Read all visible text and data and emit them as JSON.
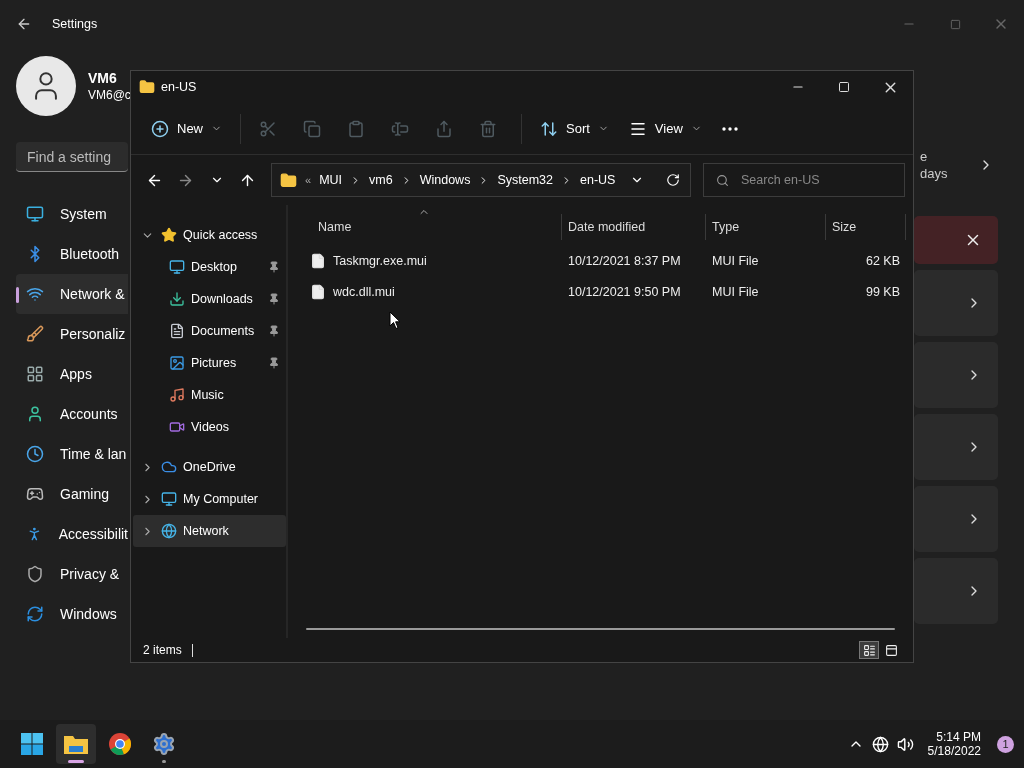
{
  "settings": {
    "title": "Settings",
    "profile": {
      "name": "VM6",
      "email": "VM6@c"
    },
    "search": {
      "placeholder": "Find a setting"
    },
    "nav": [
      {
        "kind": "system",
        "label": "System",
        "selected": false
      },
      {
        "kind": "bluetooth",
        "label": "Bluetooth",
        "selected": false
      },
      {
        "kind": "network",
        "label": "Network &",
        "selected": true
      },
      {
        "kind": "personalization",
        "label": "Personaliz",
        "selected": false
      },
      {
        "kind": "apps",
        "label": "Apps",
        "selected": false
      },
      {
        "kind": "accounts",
        "label": "Accounts",
        "selected": false
      },
      {
        "kind": "time",
        "label": "Time & lan",
        "selected": false
      },
      {
        "kind": "gaming",
        "label": "Gaming",
        "selected": false
      },
      {
        "kind": "accessibility",
        "label": "Accessibilit",
        "selected": false
      },
      {
        "kind": "privacy",
        "label": "Privacy &",
        "selected": false
      },
      {
        "kind": "update",
        "label": "Windows",
        "selected": false
      }
    ],
    "cards": [
      {
        "kind": "info",
        "lines": [
          "e",
          "days"
        ]
      },
      {
        "kind": "alert"
      },
      {
        "kind": "link"
      },
      {
        "kind": "link"
      },
      {
        "kind": "link"
      },
      {
        "kind": "link"
      },
      {
        "kind": "link"
      }
    ]
  },
  "explorer": {
    "title": "en-US",
    "toolbar": [
      {
        "kind": "new",
        "label": "New",
        "disabled": false
      },
      {
        "kind": "cut",
        "disabled": true
      },
      {
        "kind": "copy",
        "disabled": true
      },
      {
        "kind": "paste",
        "disabled": true
      },
      {
        "kind": "rename",
        "disabled": true
      },
      {
        "kind": "share",
        "disabled": true
      },
      {
        "kind": "delete",
        "disabled": true
      },
      {
        "kind": "sort",
        "label": "Sort",
        "disabled": false
      },
      {
        "kind": "view",
        "label": "View",
        "disabled": false
      },
      {
        "kind": "more",
        "disabled": false
      }
    ],
    "nav_buttons": [
      {
        "kind": "back",
        "disabled": false
      },
      {
        "kind": "forward",
        "disabled": true
      },
      {
        "kind": "recent",
        "disabled": false
      },
      {
        "kind": "up",
        "disabled": false
      }
    ],
    "address": {
      "overflow": "«",
      "segments": [
        "MUI",
        "vm6",
        "Windows",
        "System32",
        "en-US"
      ]
    },
    "search": {
      "placeholder": "Search en-US"
    },
    "tree": [
      {
        "kind": "quick",
        "label": "Quick access",
        "expanded": true,
        "selected": false,
        "children": [
          {
            "kind": "desktop",
            "label": "Desktop",
            "pinned": true,
            "selected": false
          },
          {
            "kind": "downloads",
            "label": "Downloads",
            "pinned": true,
            "selected": false
          },
          {
            "kind": "documents",
            "label": "Documents",
            "pinned": true,
            "selected": false
          },
          {
            "kind": "pictures",
            "label": "Pictures",
            "pinned": true,
            "selected": false
          },
          {
            "kind": "music",
            "label": "Music",
            "pinned": false,
            "selected": false
          },
          {
            "kind": "videos",
            "label": "Videos",
            "pinned": false,
            "selected": false
          }
        ]
      },
      {
        "kind": "onedrive",
        "label": "OneDrive",
        "expanded": false,
        "selected": false
      },
      {
        "kind": "computer",
        "label": "My Computer",
        "expanded": false,
        "selected": false
      },
      {
        "kind": "network",
        "label": "Network",
        "expanded": false,
        "selected": true
      }
    ],
    "table": {
      "columns": [
        "Name",
        "Date modified",
        "Type",
        "Size"
      ],
      "rows": [
        {
          "cells": [
            "Taskmgr.exe.mui",
            "10/12/2021 8:37 PM",
            "MUI File",
            "62 KB"
          ]
        },
        {
          "cells": [
            "wdc.dll.mui",
            "10/12/2021 9:50 PM",
            "MUI File",
            "99 KB"
          ]
        }
      ]
    },
    "status": "2 items",
    "views": [
      {
        "kind": "details",
        "selected": true
      },
      {
        "kind": "tiles",
        "selected": false
      }
    ]
  },
  "taskbar": {
    "apps": [
      {
        "kind": "start",
        "active": false
      },
      {
        "kind": "explorer",
        "active": true
      },
      {
        "kind": "browser",
        "active": false
      },
      {
        "kind": "settings",
        "active": false,
        "running": true
      }
    ],
    "time": "5:14 PM",
    "date": "5/18/2022",
    "badge": "1"
  }
}
